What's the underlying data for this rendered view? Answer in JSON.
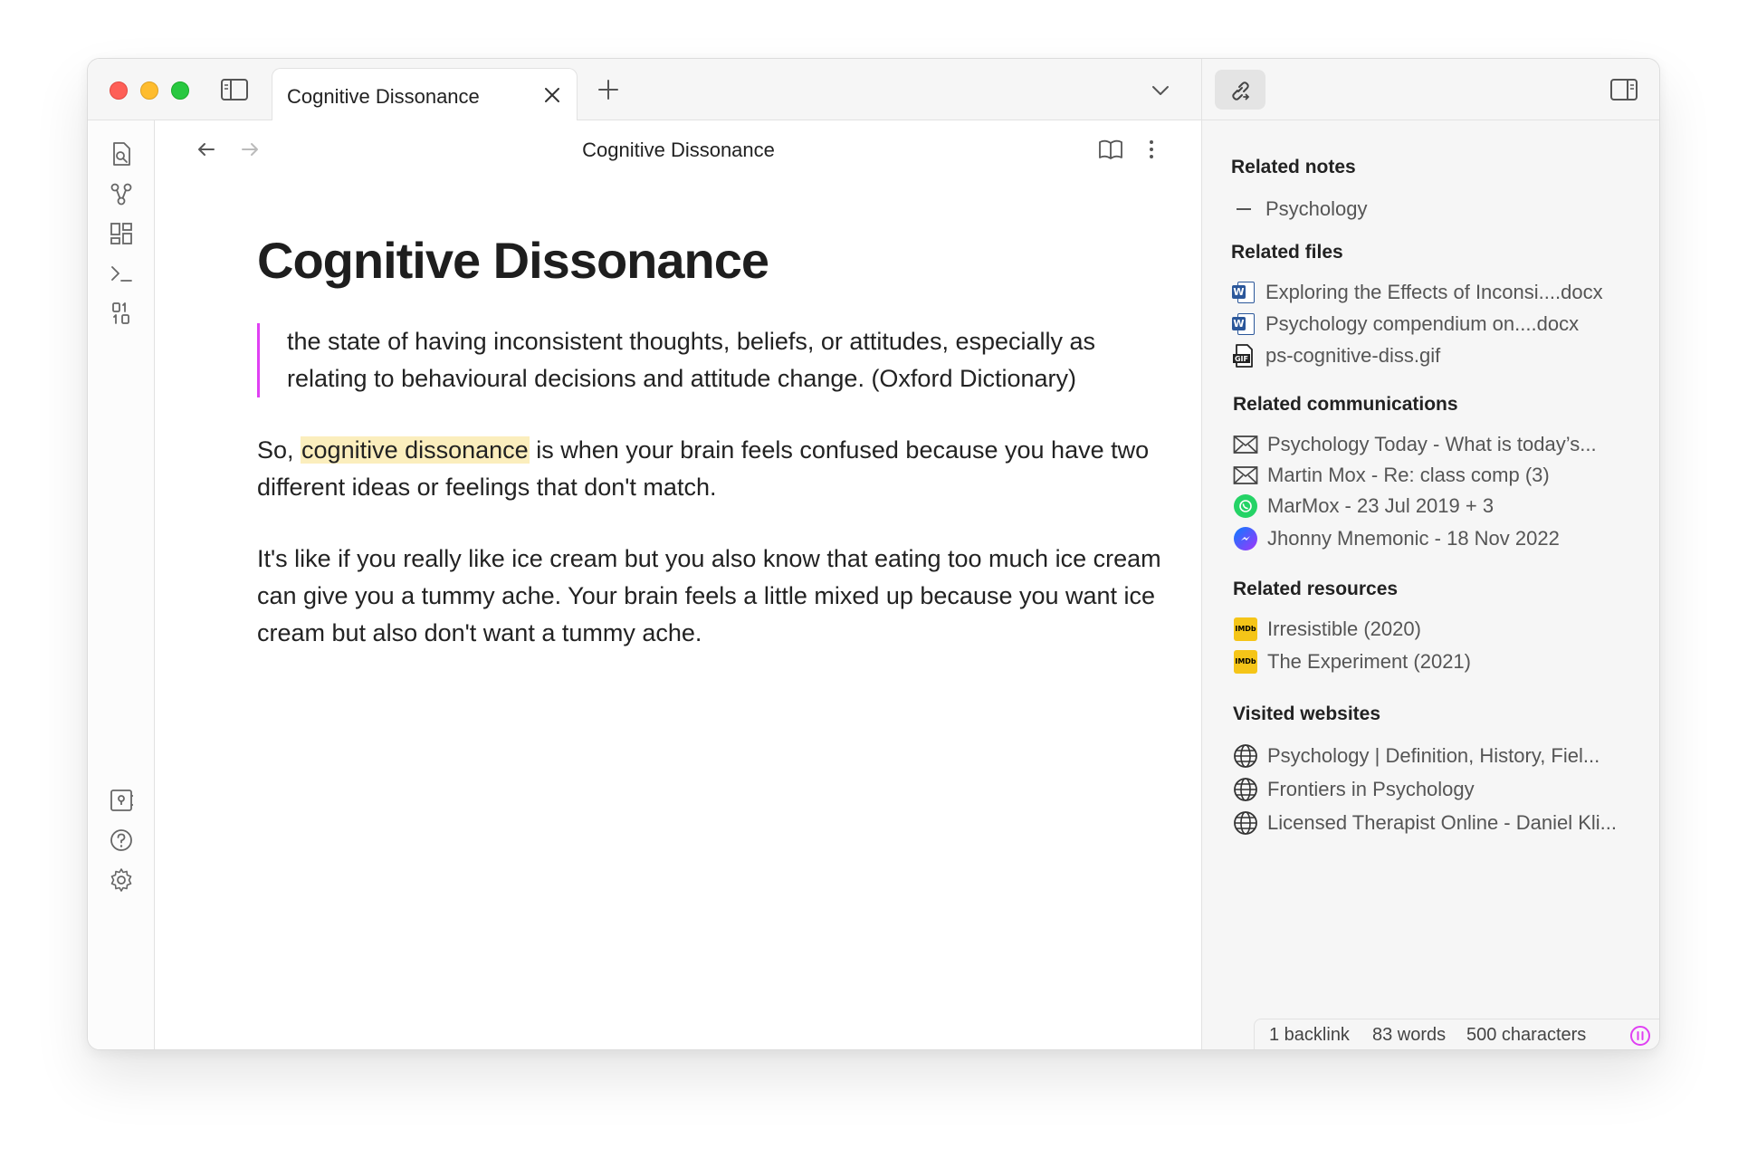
{
  "tabs": [
    {
      "label": "Cognitive Dissonance"
    }
  ],
  "view": {
    "title": "Cognitive Dissonance"
  },
  "note": {
    "heading": "Cognitive Dissonance",
    "quote": "the state of having inconsistent thoughts, beliefs, or attitudes, especially as relating to behavioural decisions and attitude change. (Oxford Dictionary)",
    "para1_before": "So, ",
    "para1_highlight": "cognitive dissonance",
    "para1_after": " is when your brain feels confused because you have two different ideas or feelings that don't match.",
    "para2": "It's like if you really like ice cream but you also know that eating too much ice cream can give you a tummy ache. Your brain feels a little mixed up because you want ice cream but also don't want a tummy ache."
  },
  "ribbon": {
    "top": [
      "search-files-icon",
      "graph-view-icon",
      "canvas-icon",
      "command-palette-icon",
      "random-note-icon"
    ],
    "bottom": [
      "vault-switcher-icon",
      "help-icon",
      "settings-icon"
    ]
  },
  "sidebar": {
    "related_notes": {
      "title": "Related notes",
      "items": [
        {
          "label": "Psychology",
          "icon": "dash-icon"
        }
      ]
    },
    "related_files": {
      "title": "Related files",
      "items": [
        {
          "label": "Exploring the Effects of Inconsi....docx",
          "icon": "word-doc-icon"
        },
        {
          "label": "Psychology compendium on....docx",
          "icon": "word-doc-icon"
        },
        {
          "label": "ps-cognitive-diss.gif",
          "icon": "gif-file-icon"
        }
      ]
    },
    "related_communications": {
      "title": "Related communications",
      "items": [
        {
          "label": "Psychology Today - What is today’s...",
          "icon": "mail-icon"
        },
        {
          "label": "Martin Mox - Re: class comp (3)",
          "icon": "mail-icon"
        },
        {
          "label": "MarMox - 23 Jul 2019 + 3",
          "icon": "whatsapp-icon"
        },
        {
          "label": "Jhonny Mnemonic - 18 Nov 2022",
          "icon": "messenger-icon"
        }
      ]
    },
    "related_resources": {
      "title": "Related resources",
      "items": [
        {
          "label": "Irresistible (2020)",
          "icon": "imdb-icon"
        },
        {
          "label": "The Experiment (2021)",
          "icon": "imdb-icon"
        }
      ]
    },
    "visited_websites": {
      "title": "Visited websites",
      "items": [
        {
          "label": "Psychology | Definition, History, Fiel...",
          "icon": "globe-icon"
        },
        {
          "label": "Frontiers in Psychology",
          "icon": "globe-icon"
        },
        {
          "label": "Licensed Therapist Online - Daniel Kli...",
          "icon": "globe-icon"
        }
      ]
    }
  },
  "status": {
    "backlinks": "1 backlink",
    "words": "83 words",
    "characters": "500 characters"
  },
  "icons": {
    "imdb": "IMDb",
    "gif": "GIF"
  },
  "colors": {
    "accent": "#e040f3",
    "highlight": "#fbeebd",
    "word": "#2b579a",
    "whatsapp": "#25d366",
    "imdb": "#f5c518"
  }
}
